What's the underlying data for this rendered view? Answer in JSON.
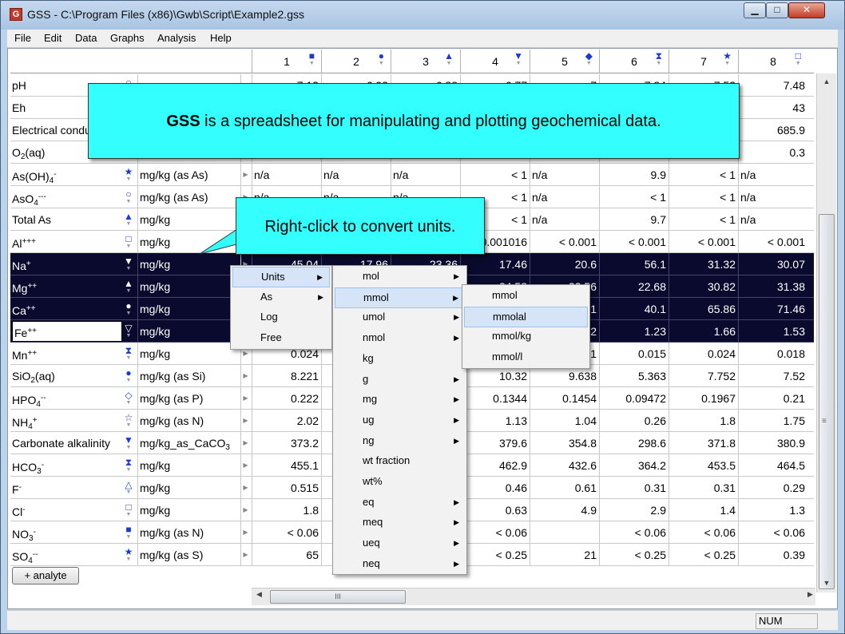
{
  "window": {
    "title": "GSS - C:\\Program Files (x86)\\Gwb\\Script\\Example2.gss",
    "app_icon": "gss-app-icon"
  },
  "menubar": [
    "File",
    "Edit",
    "Data",
    "Graphs",
    "Analysis",
    "Help"
  ],
  "columns": [
    {
      "num": "1",
      "icon": "■"
    },
    {
      "num": "2",
      "icon": "●"
    },
    {
      "num": "3",
      "icon": "▲"
    },
    {
      "num": "4",
      "icon": "▼"
    },
    {
      "num": "5",
      "icon": "◆"
    },
    {
      "num": "6",
      "icon": "⧗"
    },
    {
      "num": "7",
      "icon": "★"
    },
    {
      "num": "8",
      "icon": "□"
    }
  ],
  "rows": [
    {
      "label": "pH",
      "sym": "○",
      "unit": "",
      "sel": false,
      "cells": [
        "7.13",
        "6.93",
        "6.88",
        "6.77",
        "7",
        "7.84",
        "7.53",
        "7.48"
      ]
    },
    {
      "label": "Eh",
      "sym": "",
      "unit": "",
      "sel": false,
      "cells": [
        "",
        "",
        "",
        "",
        "",
        "",
        "",
        "43"
      ]
    },
    {
      "label": "Electrical conductivity",
      "sym": "",
      "unit": "",
      "sel": false,
      "cells": [
        "",
        "",
        "",
        "",
        "",
        "",
        "",
        "685.9"
      ]
    },
    {
      "label_html": "O<span class=\"sub\">2</span>(aq)",
      "sym": "",
      "unit": "",
      "sel": false,
      "cells": [
        "",
        "",
        "",
        "",
        "",
        "",
        "",
        "0.3"
      ]
    },
    {
      "label_html": "As(OH)<span class=\"sub\">4</span><span class=\"sup\">-</span>",
      "sym": "★",
      "unit": "mg/kg (as As)",
      "sel": false,
      "cells": [
        "n/a",
        "n/a",
        "n/a",
        "< 1",
        "n/a",
        "9.9",
        "< 1",
        "n/a"
      ]
    },
    {
      "label_html": "AsO<span class=\"sub\">4</span><span class=\"sup\">---</span>",
      "sym": "○",
      "unit": "mg/kg (as As)",
      "sel": false,
      "cells": [
        "n/a",
        "n/a",
        "n/a",
        "< 1",
        "n/a",
        "< 1",
        "< 1",
        "n/a"
      ]
    },
    {
      "label": "Total As",
      "sym": "▲",
      "unit": "mg/kg",
      "sel": false,
      "cells": [
        "",
        "",
        "",
        "< 1",
        "n/a",
        "9.7",
        "< 1",
        "n/a"
      ]
    },
    {
      "label_html": "Al<span class=\"sup\">+++</span>",
      "sym": "□",
      "unit": "mg/kg",
      "sel": false,
      "cells": [
        "",
        "",
        "",
        "0.001016",
        "< 0.001",
        "< 0.001",
        "< 0.001",
        "< 0.001"
      ]
    },
    {
      "label_html": "Na<span class=\"sup\">+</span>",
      "sym": "▼",
      "unit": "mg/kg",
      "sel": true,
      "cells": [
        "45.04",
        "17.96",
        "23.36",
        "17.46",
        "20.6",
        "56.1",
        "31.32",
        "30.07"
      ]
    },
    {
      "label_html": "Mg<span class=\"sup\">++</span>",
      "sym": "▲",
      "unit": "mg/kg",
      "sel": true,
      "cells": [
        "",
        "",
        "",
        "34.58",
        "33.56",
        "22.68",
        "30.82",
        "31.38"
      ]
    },
    {
      "label_html": "Ca<span class=\"sup\">++</span>",
      "sym": "●",
      "unit": "mg/kg",
      "sel": true,
      "cells": [
        "",
        "",
        "",
        "",
        "1",
        "40.1",
        "65.86",
        "71.46"
      ]
    },
    {
      "label_html": "Fe<span class=\"sup\">++</span>",
      "sym": "▽",
      "unit": "mg/kg",
      "sel": true,
      "cells": [
        "",
        "",
        "",
        "",
        "2",
        "1.23",
        "1.66",
        "1.53"
      ]
    },
    {
      "label_html": "Mn<span class=\"sup\">++</span>",
      "sym": "⧗",
      "unit": "mg/kg",
      "sel": false,
      "cells": [
        "0.024",
        "",
        "",
        "",
        "1",
        "0.015",
        "0.024",
        "0.018"
      ]
    },
    {
      "label_html": "SiO<span class=\"sub\">2</span>(aq)",
      "sym": "●",
      "unit": "mg/kg (as Si)",
      "sel": false,
      "cells": [
        "8.221",
        "",
        "",
        "10.32",
        "9.638",
        "5.363",
        "7.752",
        "7.52"
      ]
    },
    {
      "label_html": "HPO<span class=\"sub\">4</span><span class=\"sup\">--</span>",
      "sym": "◇",
      "unit": "mg/kg (as P)",
      "sel": false,
      "cells": [
        "0.222",
        "",
        "",
        "0.1344",
        "0.1454",
        "0.09472",
        "0.1967",
        "0.21"
      ]
    },
    {
      "label_html": "NH<span class=\"sub\">4</span><span class=\"sup\">+</span>",
      "sym": "☆",
      "unit": "mg/kg (as N)",
      "sel": false,
      "cells": [
        "2.02",
        "",
        "",
        "1.13",
        "1.04",
        "0.26",
        "1.8",
        "1.75"
      ]
    },
    {
      "label": "Carbonate alkalinity",
      "sym": "▼",
      "unit_html": "mg/kg_as_CaCO<span class=\"sub\">3</span>",
      "sel": false,
      "cells": [
        "373.2",
        "",
        "",
        "379.6",
        "354.8",
        "298.6",
        "371.8",
        "380.9"
      ]
    },
    {
      "label_html": "HCO<span class=\"sub\">3</span><span class=\"sup\">-</span>",
      "sym": "⧗",
      "unit": "mg/kg",
      "sel": false,
      "cells": [
        "455.1",
        "",
        "",
        "462.9",
        "432.6",
        "364.2",
        "453.5",
        "464.5"
      ]
    },
    {
      "label_html": "F<span class=\"sup\">-</span>",
      "sym": "△",
      "unit": "mg/kg",
      "sel": false,
      "cells": [
        "0.515",
        "",
        "",
        "0.46",
        "0.61",
        "0.31",
        "0.31",
        "0.29"
      ]
    },
    {
      "label_html": "Cl<span class=\"sup\">-</span>",
      "sym": "□",
      "unit": "mg/kg",
      "sel": false,
      "cells": [
        "1.8",
        "",
        "",
        "0.63",
        "4.9",
        "2.9",
        "1.4",
        "1.3"
      ]
    },
    {
      "label_html": "NO<span class=\"sub\">3</span><span class=\"sup\">-</span>",
      "sym": "■",
      "unit": "mg/kg (as N)",
      "sel": false,
      "cells": [
        "< 0.06",
        "",
        "",
        "< 0.06",
        "",
        "< 0.06",
        "< 0.06",
        "< 0.06"
      ]
    },
    {
      "label_html": "SO<span class=\"sub\">4</span><span class=\"sup\">--</span>",
      "sym": "★",
      "unit": "mg/kg (as S)",
      "sel": false,
      "cells": [
        "65",
        "",
        "",
        "< 0.25",
        "21",
        "< 0.25",
        "< 0.25",
        "0.39"
      ]
    }
  ],
  "add_analyte_label": "+ analyte",
  "hscroll_grip": "III",
  "status": {
    "num": "NUM"
  },
  "callouts": {
    "main_bold": "GSS",
    "main_rest": " is a spreadsheet for manipulating and plotting geochemical data.",
    "units_tip": "Right-click to convert units."
  },
  "context_menu": [
    {
      "label": "Units",
      "sub": true,
      "hl": true
    },
    {
      "label": "As",
      "sub": true,
      "hl": false
    },
    {
      "label": "Log",
      "sub": false,
      "hl": false
    },
    {
      "label": "Free",
      "sub": false,
      "hl": false
    }
  ],
  "units_menu": [
    {
      "label": "mol",
      "sub": true,
      "hl": false
    },
    {
      "label": "mmol",
      "sub": true,
      "hl": true
    },
    {
      "label": "umol",
      "sub": true,
      "hl": false
    },
    {
      "label": "nmol",
      "sub": true,
      "hl": false
    },
    {
      "label": "kg",
      "sub": false,
      "hl": false
    },
    {
      "label": "g",
      "sub": true,
      "hl": false
    },
    {
      "label": "mg",
      "sub": true,
      "hl": false
    },
    {
      "label": "ug",
      "sub": true,
      "hl": false
    },
    {
      "label": "ng",
      "sub": true,
      "hl": false
    },
    {
      "label": "wt fraction",
      "sub": false,
      "hl": false
    },
    {
      "label": "wt%",
      "sub": false,
      "hl": false
    },
    {
      "label": "eq",
      "sub": true,
      "hl": false
    },
    {
      "label": "meq",
      "sub": true,
      "hl": false
    },
    {
      "label": "ueq",
      "sub": true,
      "hl": false
    },
    {
      "label": "neq",
      "sub": true,
      "hl": false
    }
  ],
  "mmol_menu": [
    {
      "label": "mmol",
      "hl": false
    },
    {
      "label": "mmolal",
      "hl": true
    },
    {
      "label": "mmol/kg",
      "hl": false
    },
    {
      "label": "mmol/l",
      "hl": false
    }
  ]
}
